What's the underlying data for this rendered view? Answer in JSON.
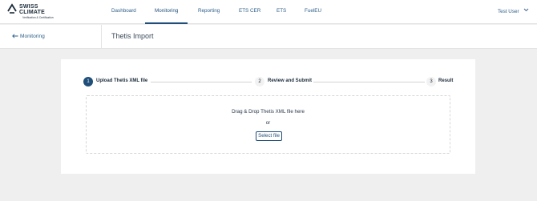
{
  "brand": {
    "line1": "SWISS",
    "line2": "CLIMATE",
    "tagline": "Verification & Certification"
  },
  "nav": {
    "items": [
      {
        "label": "Dashboard"
      },
      {
        "label": "Monitoring",
        "active": true
      },
      {
        "label": "Reporting"
      },
      {
        "label": "ETS CER"
      },
      {
        "label": "ETS"
      },
      {
        "label": "FuelEU"
      }
    ]
  },
  "user": {
    "name": "Test User"
  },
  "subheader": {
    "back_label": "Monitoring",
    "title": "Thetis Import"
  },
  "stepper": {
    "steps": [
      {
        "number": "1",
        "label": "Upload Thetis XML file",
        "active": true
      },
      {
        "number": "2",
        "label": "Review and Submit",
        "active": false
      },
      {
        "number": "3",
        "label": "Result",
        "active": false
      }
    ]
  },
  "dropzone": {
    "instruction": "Drag & Drop Thetis XML file here",
    "or_text": "or",
    "button_label": "Select file"
  },
  "colors": {
    "accent": "#1f4e79",
    "link": "#2e5e88",
    "page_bg": "#efefef"
  }
}
